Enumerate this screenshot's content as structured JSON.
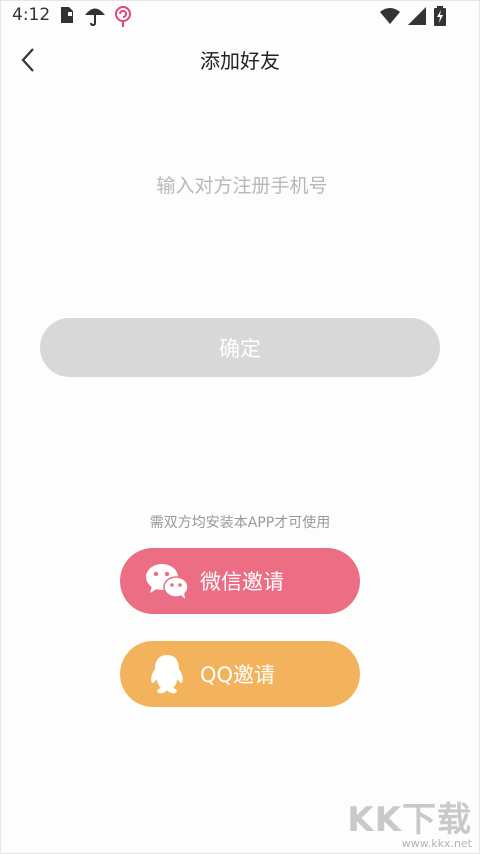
{
  "colors": {
    "wechat_button": "#eb6e84",
    "qq_button": "#f2b35c",
    "confirm_button": "#d8d8d8",
    "notification_icon": "#e0457b"
  },
  "status_bar": {
    "time": "4:12",
    "icons": [
      "sim-card-icon",
      "umbrella-icon",
      "lollipop-icon",
      "wifi-icon",
      "signal-icon",
      "battery-charging-icon"
    ]
  },
  "header": {
    "title": "添加好友",
    "back_icon": "chevron-left-icon"
  },
  "form": {
    "phone_placeholder": "输入对方注册手机号",
    "phone_value": "",
    "confirm_label": "确定"
  },
  "invite": {
    "hint": "需双方均安装本APP才可使用",
    "wechat_label": "微信邀请",
    "wechat_icon": "wechat-icon",
    "qq_label": "QQ邀请",
    "qq_icon": "qq-penguin-icon"
  },
  "watermark": {
    "brand": "KK下载",
    "url": "www.kkx.net"
  }
}
